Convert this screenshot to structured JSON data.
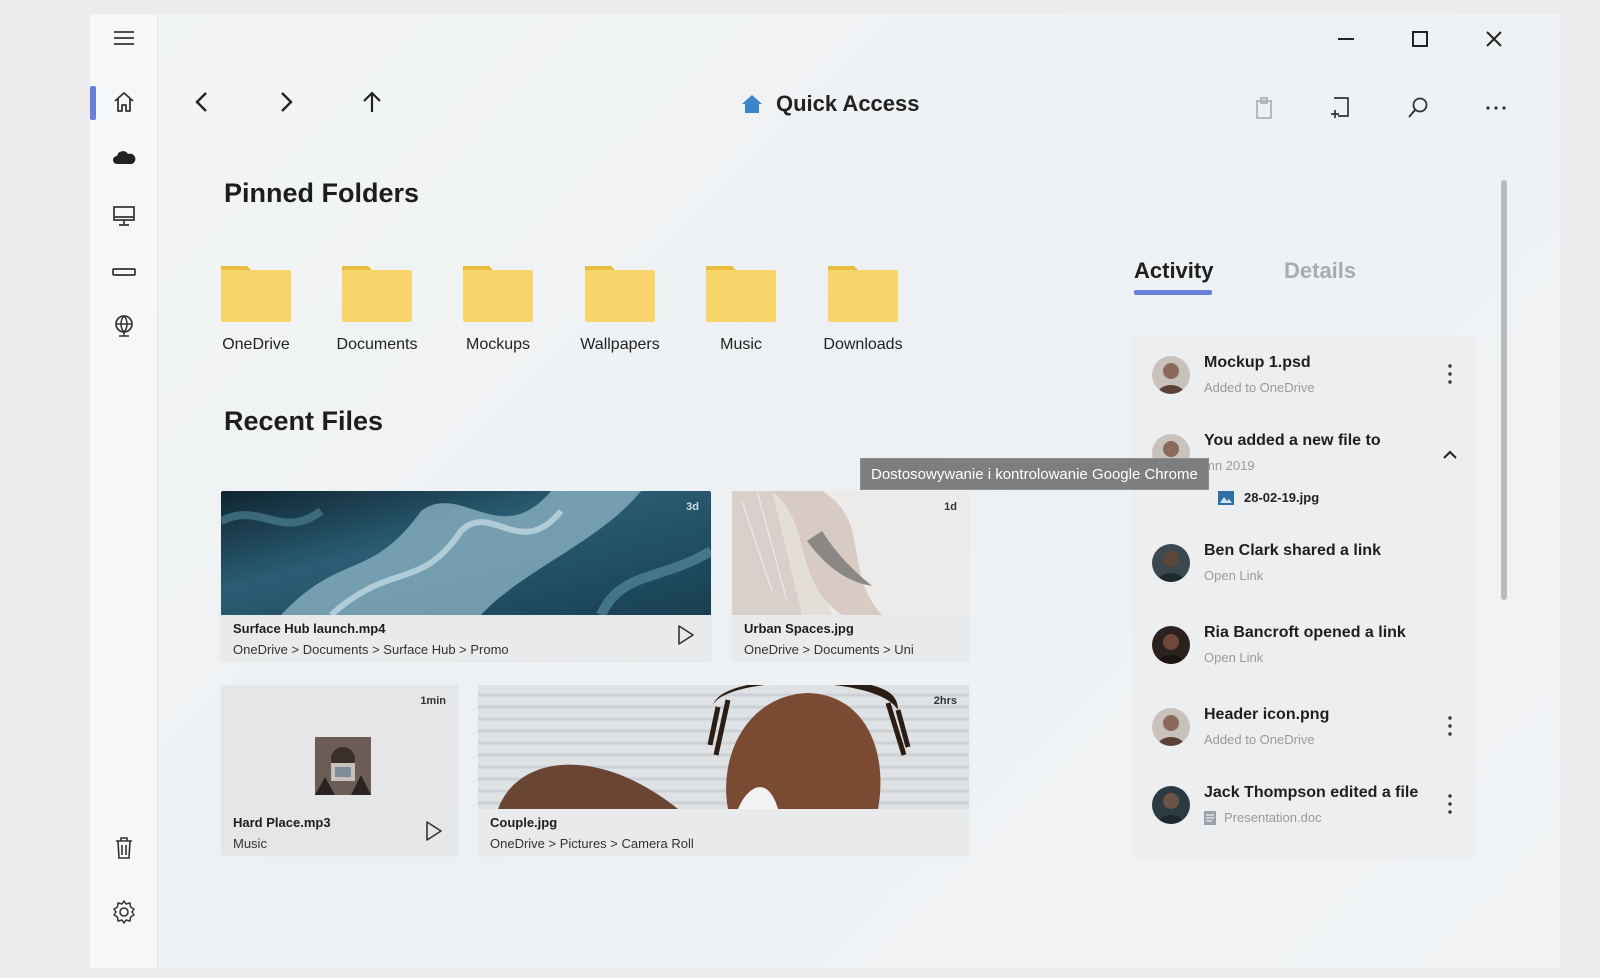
{
  "window": {
    "title": "Quick Access",
    "controls": {
      "minimize": "minimize-icon",
      "maximize": "maximize-icon",
      "close": "close-icon"
    }
  },
  "rail": {
    "items": [
      {
        "name": "menu",
        "icon": "hamburger-icon"
      },
      {
        "name": "home",
        "icon": "home-icon",
        "active": true
      },
      {
        "name": "onedrive",
        "icon": "cloud-icon"
      },
      {
        "name": "this-pc",
        "icon": "monitor-icon"
      },
      {
        "name": "drive",
        "icon": "drive-icon"
      },
      {
        "name": "network",
        "icon": "globe-icon"
      },
      {
        "name": "recycle-bin",
        "icon": "trash-icon"
      },
      {
        "name": "settings",
        "icon": "gear-icon"
      }
    ]
  },
  "sections": {
    "pinned": "Pinned Folders",
    "recent": "Recent Files"
  },
  "folders": [
    {
      "label": "OneDrive"
    },
    {
      "label": "Documents"
    },
    {
      "label": "Mockups"
    },
    {
      "label": "Wallpapers"
    },
    {
      "label": "Music"
    },
    {
      "label": "Downloads"
    }
  ],
  "files": [
    {
      "name": "Surface Hub launch.mp4",
      "path": "OneDrive > Documents > Surface Hub > Promo",
      "age": "3d"
    },
    {
      "name": "Urban Spaces.jpg",
      "path": "OneDrive > Documents > Uni",
      "age": "1d"
    },
    {
      "name": "Hard Place.mp3",
      "path": "Music",
      "age": "1min"
    },
    {
      "name": "Couple.jpg",
      "path": "OneDrive > Pictures > Camera Roll",
      "age": "2hrs"
    }
  ],
  "panel": {
    "tabs": {
      "activity": "Activity",
      "details": "Details"
    },
    "activity": [
      {
        "title": "Mockup 1.psd",
        "sub": "Added to OneDrive"
      },
      {
        "title": "You added a new file to",
        "sub": "mn 2019",
        "attachment": "28-02-19.jpg"
      },
      {
        "title": "Ben Clark shared a link",
        "sub": "Open Link"
      },
      {
        "title": "Ria Bancroft opened a link",
        "sub": "Open Link"
      },
      {
        "title": "Header icon.png",
        "sub": "Added to OneDrive"
      },
      {
        "title": "Jack Thompson edited a file",
        "sub": "Presentation.doc"
      }
    ]
  },
  "tooltip": "Dostosowywanie i kontrolowanie Google Chrome",
  "colors": {
    "accent": "#6a7fd8",
    "folder": "#f7d56a",
    "folder_tab": "#e9bd3d"
  }
}
